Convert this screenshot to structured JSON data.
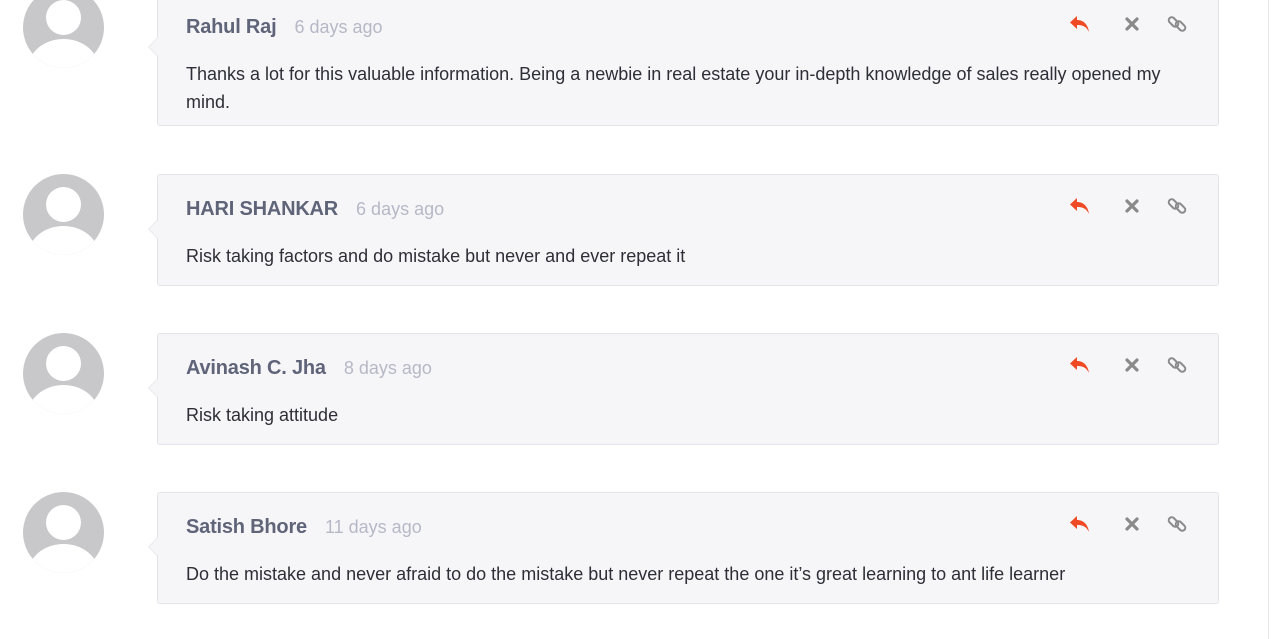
{
  "colors": {
    "reply_icon": "#f04a25",
    "action_icon": "#8a8a8a",
    "card_bg": "#f6f6f9",
    "author": "#5f6478",
    "date": "#b6b8c6"
  },
  "icons": {
    "reply": "reply-arrow-icon",
    "delete": "close-x-icon",
    "permalink": "link-icon"
  },
  "comments": [
    {
      "author": "Rahul Raj",
      "date": "6 days ago",
      "text": "Thanks a lot for this valuable information. Being a newbie in real estate your in-depth knowledge of sales really opened my mind."
    },
    {
      "author": "HARI SHANKAR",
      "date": "6 days ago",
      "text": "Risk taking factors and do mistake but never and ever repeat it"
    },
    {
      "author": "Avinash C. Jha",
      "date": "8 days ago",
      "text": "Risk taking attitude"
    },
    {
      "author": "Satish Bhore",
      "date": "11 days ago",
      "text": "Do the mistake and never afraid to do the mistake but never repeat the one it’s great learning to ant life learner"
    }
  ]
}
